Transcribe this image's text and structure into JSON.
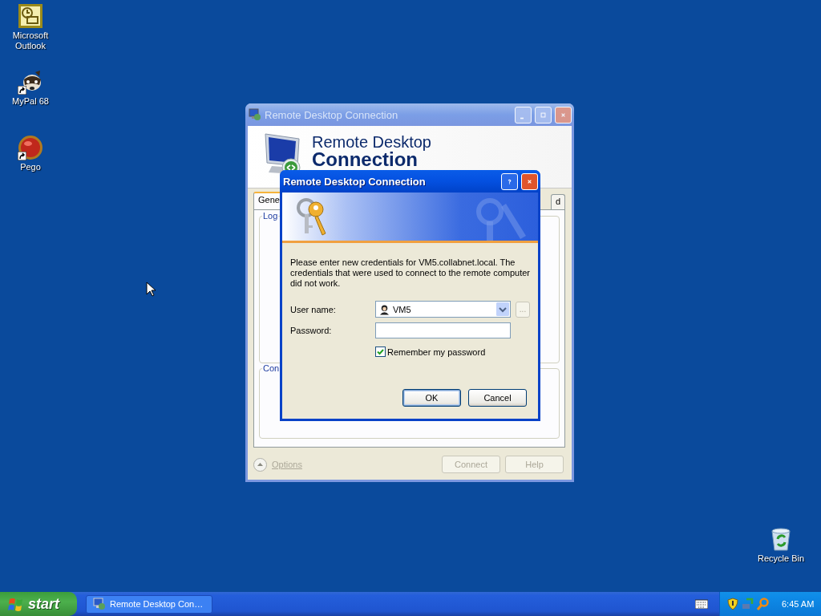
{
  "desktop_icons": [
    {
      "label": "Microsoft Outlook",
      "kind": "outlook",
      "shortcut": false
    },
    {
      "label": "MyPal 68",
      "kind": "raccoon",
      "shortcut": true
    },
    {
      "label": "Pego",
      "kind": "orb",
      "shortcut": true
    },
    {
      "label": "Recycle Bin",
      "kind": "bin",
      "shortcut": false
    }
  ],
  "main_window": {
    "title": "Remote Desktop Connection",
    "active": false,
    "header_line1": "Remote Desktop",
    "header_line2": "Connection",
    "tabs": [
      {
        "label": "Gene",
        "selected": true
      },
      {
        "label": "d",
        "selected": false
      }
    ],
    "groups": [
      "Log",
      "Con"
    ],
    "options_link": {
      "label": "Options",
      "disabled": true
    },
    "buttons": [
      {
        "label": "Connect",
        "disabled": true
      },
      {
        "label": "Help",
        "disabled": true
      }
    ]
  },
  "dialog": {
    "title": "Remote Desktop Connection",
    "active": true,
    "message": "Please enter new credentials for VM5.collabnet.local. The credentials that were used to connect to the remote computer did not work.",
    "fields": [
      {
        "label": "User name:",
        "kind": "combo",
        "value": "VM5",
        "extra_button": "..."
      },
      {
        "label": "Password:",
        "kind": "password"
      }
    ],
    "remember": {
      "label": "Remember my password",
      "checked": true
    },
    "buttons": [
      {
        "label": "OK",
        "default": true
      },
      {
        "label": "Cancel",
        "default": false
      }
    ]
  },
  "taskbar": {
    "start": "start",
    "tasks": [
      {
        "label": "Remote Desktop Con…",
        "selected": false
      }
    ],
    "clock": "6:45 AM"
  }
}
